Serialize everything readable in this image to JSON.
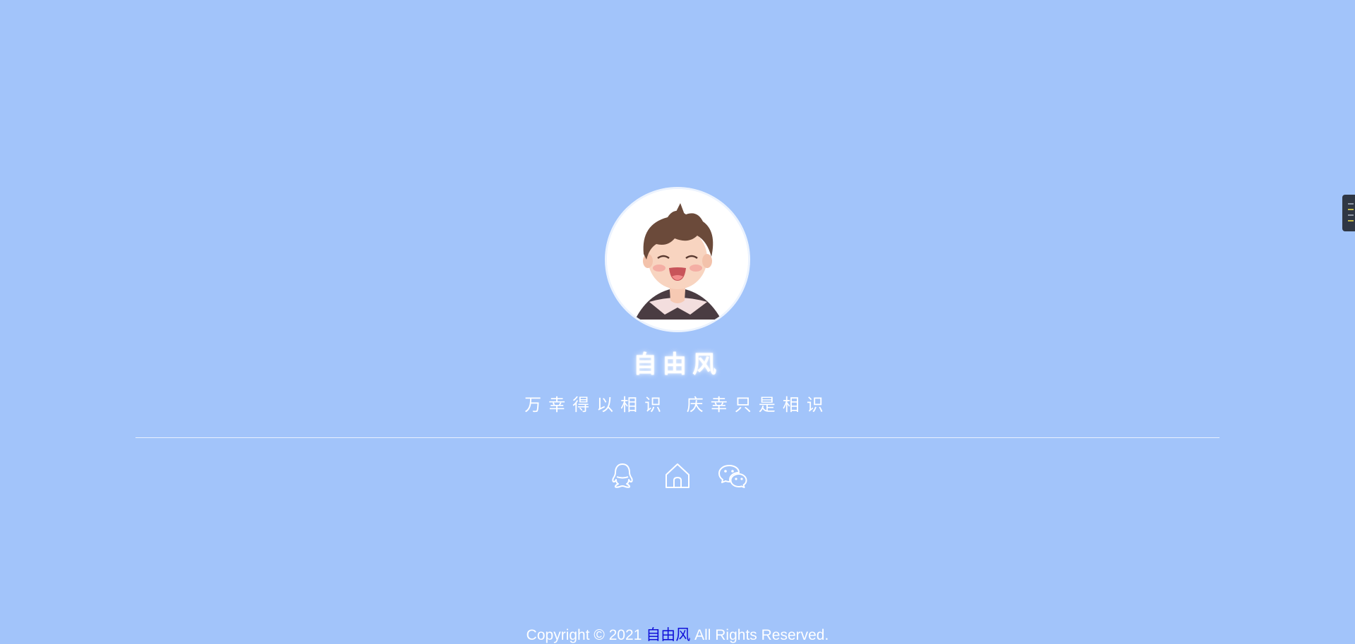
{
  "profile": {
    "name": "自由风",
    "motto": "万幸得以相识 庆幸只是相识"
  },
  "socials": [
    {
      "icon": "qq-icon"
    },
    {
      "icon": "home-icon"
    },
    {
      "icon": "wechat-icon"
    }
  ],
  "footer": {
    "prefix": "Copyright © 2021 ",
    "link_text": "自由风",
    "suffix": " All Rights Reserved."
  },
  "colors": {
    "background": "#a2c4fa",
    "text": "#ffffff",
    "link": "#1010d8"
  }
}
